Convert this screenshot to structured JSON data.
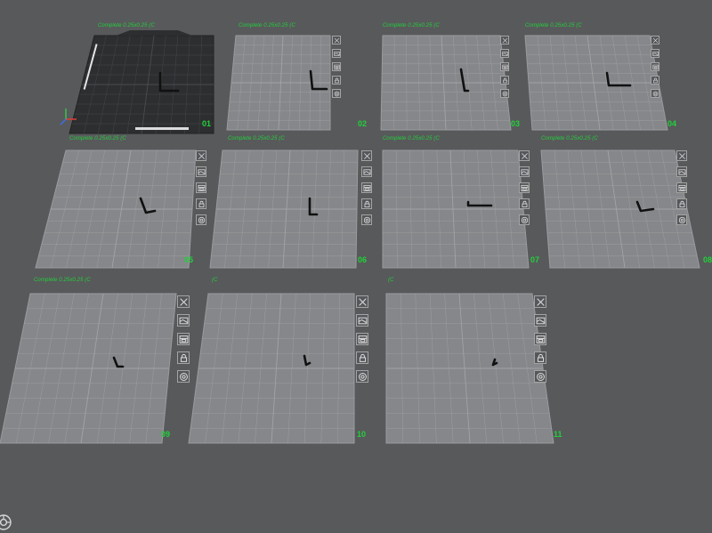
{
  "plates": [
    {
      "number": "01",
      "label": "Complete 0.25x0.25 (C",
      "active": true
    },
    {
      "number": "02",
      "label": "Complete 0.25x0.25 (C",
      "active": false
    },
    {
      "number": "03",
      "label": "Complete 0.25x0.25 (C",
      "active": false
    },
    {
      "number": "04",
      "label": "Complete 0.25x0.25 (C",
      "active": false
    },
    {
      "number": "05",
      "label": "Complete 0.25x0.25 (C",
      "active": false
    },
    {
      "number": "06",
      "label": "Complete 0.25x0.25 (C",
      "active": false
    },
    {
      "number": "07",
      "label": "Complete 0.25x0.25 (C",
      "active": false
    },
    {
      "number": "08",
      "label": "Complete 0.25x0.25 (C",
      "active": false
    },
    {
      "number": "09",
      "label": "Complete 0.25x0.25 (C",
      "active": false
    },
    {
      "number": "10",
      "label": "(C",
      "active": false
    },
    {
      "number": "11",
      "label": "(C",
      "active": false
    }
  ],
  "plate_tools": [
    {
      "name": "delete-plate-button",
      "icon": "close-icon"
    },
    {
      "name": "arrange-plate-button",
      "icon": "arrange-icon"
    },
    {
      "name": "orient-plate-button",
      "icon": "orient-icon"
    },
    {
      "name": "lock-plate-button",
      "icon": "lock-icon"
    },
    {
      "name": "plate-settings-button",
      "icon": "gear-icon"
    }
  ],
  "colors": {
    "background": "#58595b",
    "plate_fill": "#86878a",
    "grid_line": "#a2a3a6",
    "active_plate_fill": "#2d2e30",
    "active_grid_line": "#4b4c4f",
    "label_green": "#21d13a",
    "object": "#111111"
  }
}
